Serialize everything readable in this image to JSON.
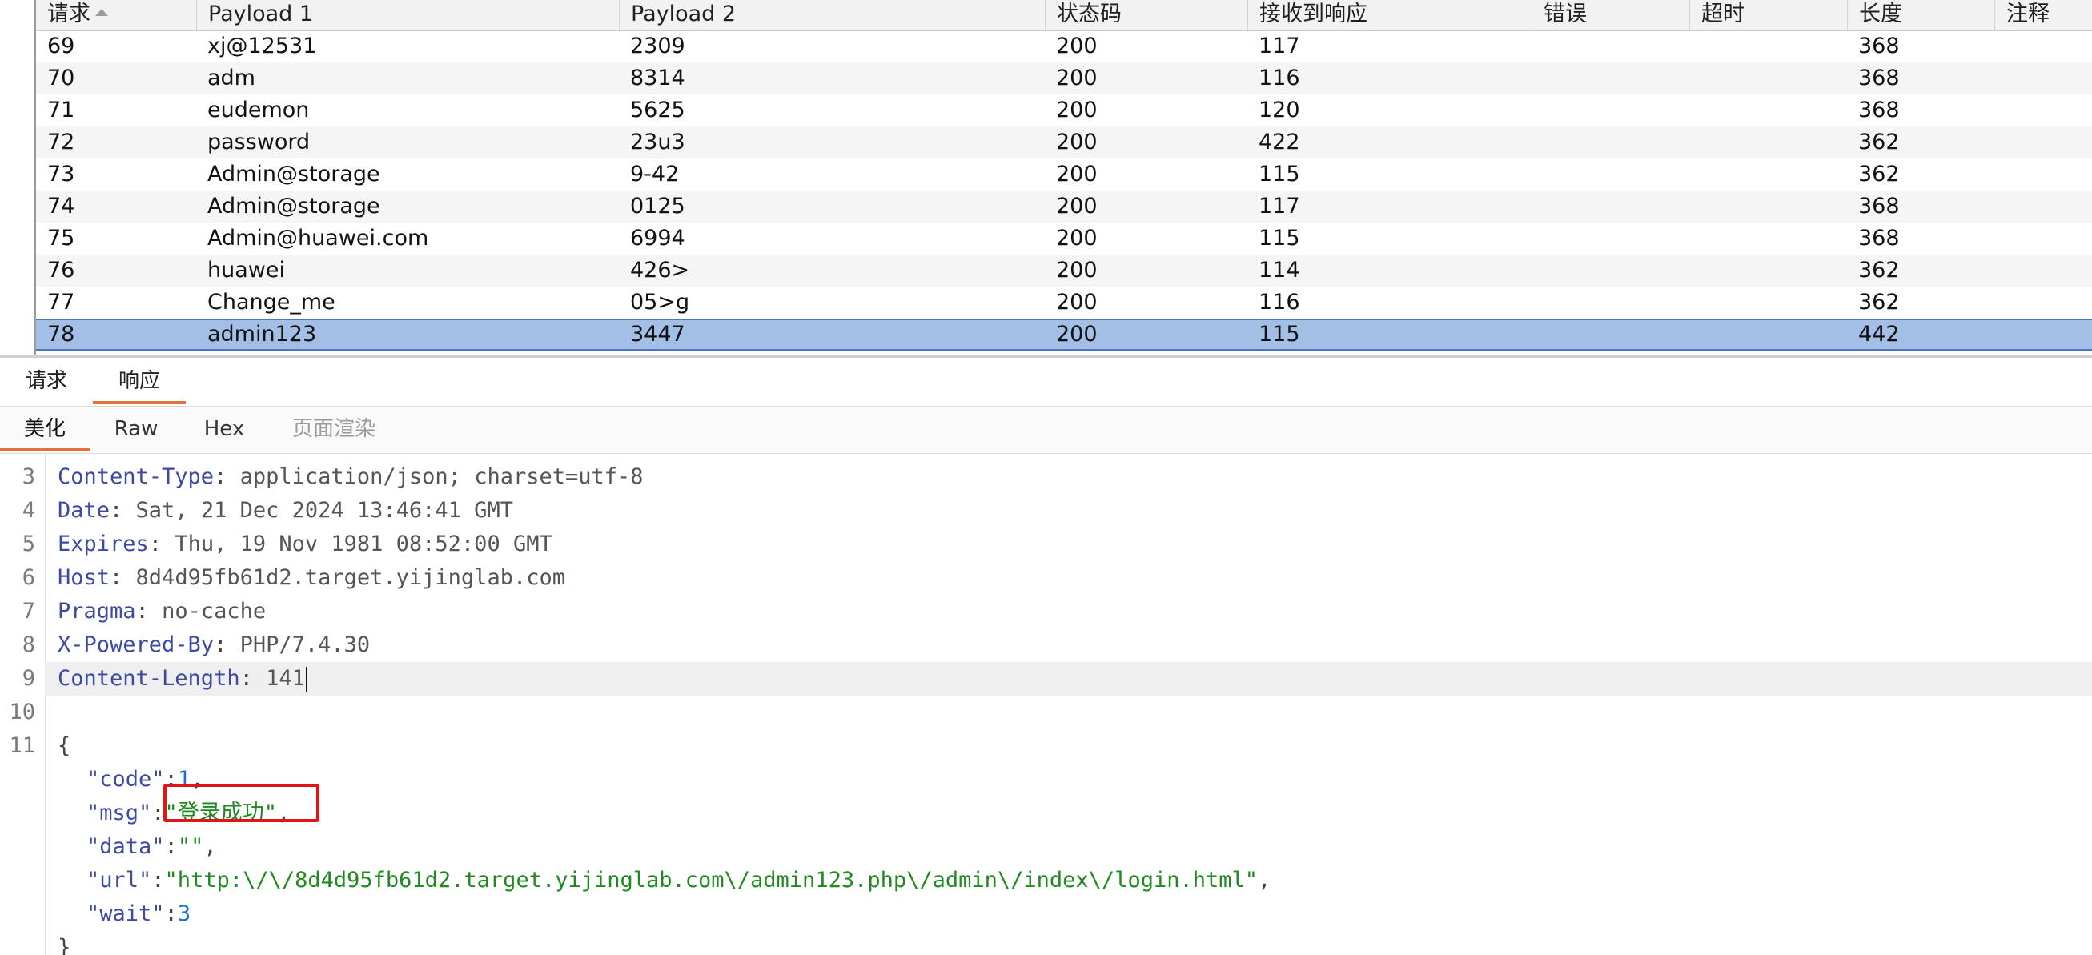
{
  "table": {
    "columns": [
      "请求",
      "Payload 1",
      "Payload 2",
      "状态码",
      "接收到响应",
      "错误",
      "超时",
      "长度",
      "注释"
    ],
    "rows": [
      {
        "req": "69",
        "p1": "xj@12531",
        "p2": "2309",
        "status": "200",
        "recv": "117",
        "error": "",
        "timeout": "",
        "length": "368",
        "comment": ""
      },
      {
        "req": "70",
        "p1": "adm",
        "p2": "8314",
        "status": "200",
        "recv": "116",
        "error": "",
        "timeout": "",
        "length": "368",
        "comment": ""
      },
      {
        "req": "71",
        "p1": "eudemon",
        "p2": "5625",
        "status": "200",
        "recv": "120",
        "error": "",
        "timeout": "",
        "length": "368",
        "comment": ""
      },
      {
        "req": "72",
        "p1": "password",
        "p2": "23u3",
        "status": "200",
        "recv": "422",
        "error": "",
        "timeout": "",
        "length": "362",
        "comment": ""
      },
      {
        "req": "73",
        "p1": "Admin@storage",
        "p2": "9-42",
        "status": "200",
        "recv": "115",
        "error": "",
        "timeout": "",
        "length": "362",
        "comment": ""
      },
      {
        "req": "74",
        "p1": "Admin@storage",
        "p2": "0125",
        "status": "200",
        "recv": "117",
        "error": "",
        "timeout": "",
        "length": "368",
        "comment": ""
      },
      {
        "req": "75",
        "p1": "Admin@huawei.com",
        "p2": "6994",
        "status": "200",
        "recv": "115",
        "error": "",
        "timeout": "",
        "length": "368",
        "comment": ""
      },
      {
        "req": "76",
        "p1": "huawei",
        "p2": "426>",
        "status": "200",
        "recv": "114",
        "error": "",
        "timeout": "",
        "length": "362",
        "comment": ""
      },
      {
        "req": "77",
        "p1": "Change_me",
        "p2": "05>g",
        "status": "200",
        "recv": "116",
        "error": "",
        "timeout": "",
        "length": "362",
        "comment": ""
      },
      {
        "req": "78",
        "p1": "admin123",
        "p2": "3447",
        "status": "200",
        "recv": "115",
        "error": "",
        "timeout": "",
        "length": "442",
        "comment": ""
      }
    ],
    "selected_req": "78"
  },
  "tabs": {
    "request": "请求",
    "response": "响应",
    "active": "响应"
  },
  "view_tabs": {
    "pretty": "美化",
    "raw": "Raw",
    "hex": "Hex",
    "render": "页面渲染",
    "active": "美化"
  },
  "response": {
    "headers": [
      {
        "line": "3",
        "key": "Content-Type",
        "value": "application/json; charset=utf-8"
      },
      {
        "line": "4",
        "key": "Date",
        "value": "Sat, 21 Dec 2024 13:46:41 GMT"
      },
      {
        "line": "5",
        "key": "Expires",
        "value": "Thu, 19 Nov 1981 08:52:00 GMT"
      },
      {
        "line": "6",
        "key": "Host",
        "value": "8d4d95fb61d2.target.yijinglab.com"
      },
      {
        "line": "7",
        "key": "Pragma",
        "value": "no-cache"
      },
      {
        "line": "8",
        "key": "X-Powered-By",
        "value": "PHP/7.4.30"
      },
      {
        "line": "9",
        "key": "Content-Length",
        "value": "141"
      }
    ],
    "blank_line": "10",
    "body_start_line": "11",
    "body": {
      "code": "1",
      "msg": "\"登录成功\"",
      "data": "\"\"",
      "url": "\"http:\\/\\/8d4d95fb61d2.target.yijinglab.com\\/admin123.php\\/admin\\/index\\/login.html\"",
      "wait": "3"
    }
  }
}
